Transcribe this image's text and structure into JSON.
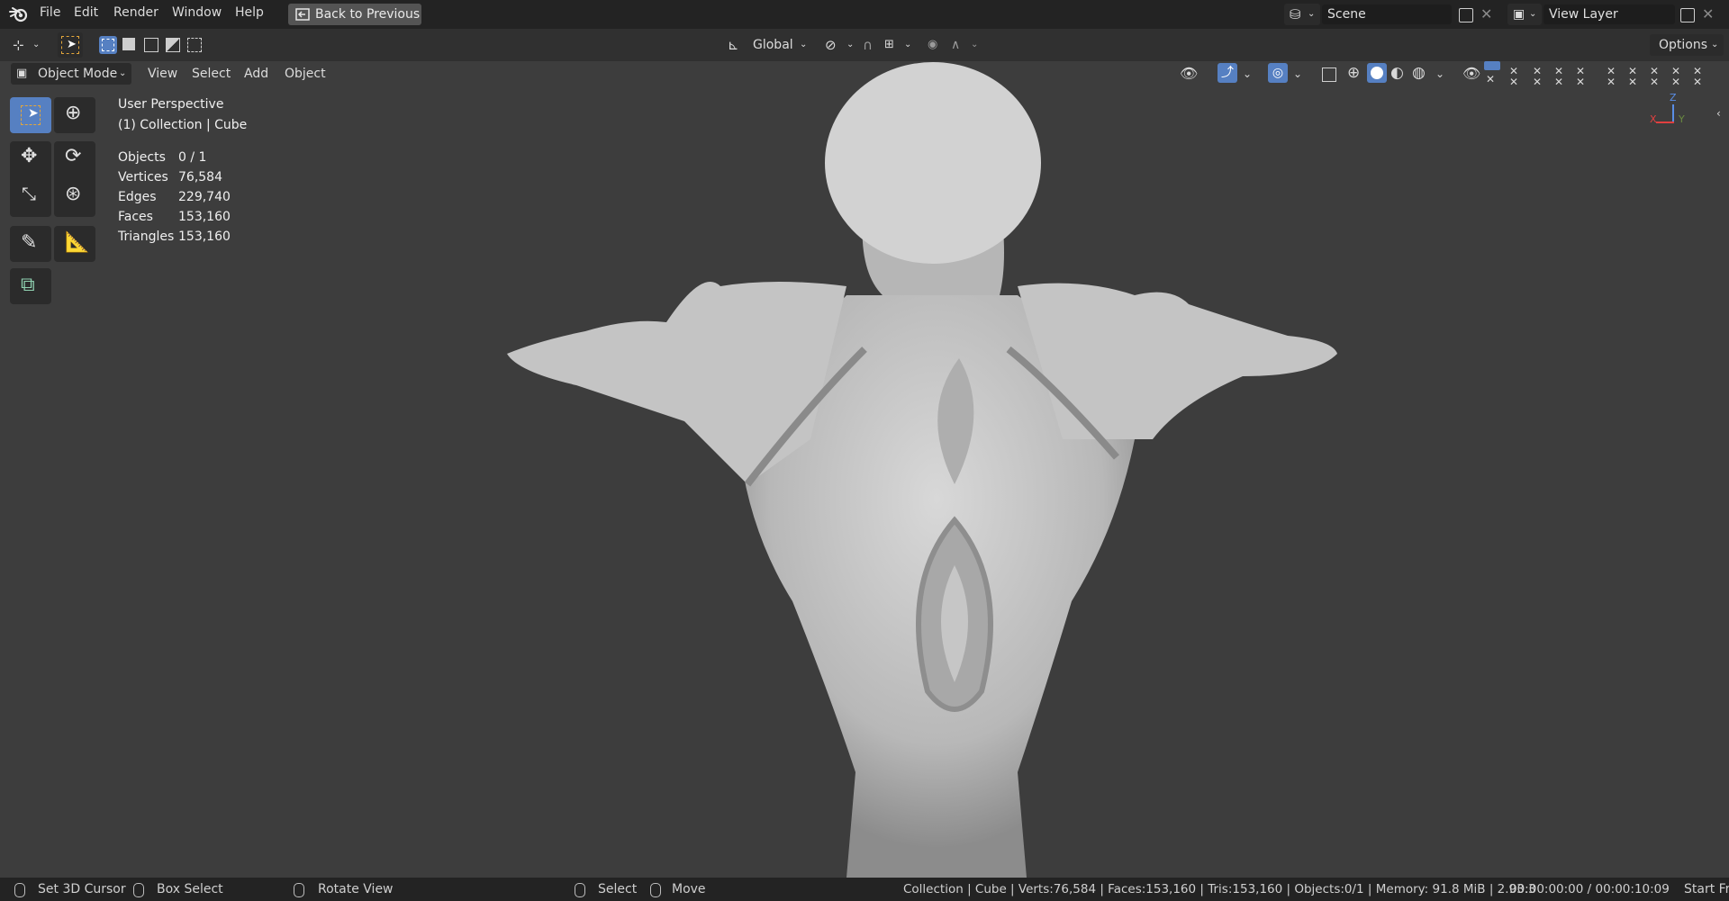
{
  "menu": {
    "file": "File",
    "edit": "Edit",
    "render": "Render",
    "window": "Window",
    "help": "Help"
  },
  "back_button": "Back to Previous",
  "scene": {
    "label": "Scene"
  },
  "view_layer": {
    "label": "View Layer"
  },
  "toolhead": {
    "orientation": "Global",
    "options": "Options"
  },
  "viewport_header": {
    "mode": "Object Mode",
    "view": "View",
    "select": "Select",
    "add": "Add",
    "object": "Object"
  },
  "viewport": {
    "perspective": "User Perspective",
    "collection": "(1) Collection | Cube",
    "stats": [
      {
        "label": "Objects",
        "value": "0 / 1"
      },
      {
        "label": "Vertices",
        "value": "76,584"
      },
      {
        "label": "Edges",
        "value": "229,740"
      },
      {
        "label": "Faces",
        "value": "153,160"
      },
      {
        "label": "Triangles",
        "value": "153,160"
      }
    ],
    "gizmo": {
      "z": "Z",
      "x": "X",
      "y": "Y"
    }
  },
  "statusbar": {
    "set_cursor": "Set 3D Cursor",
    "box_select": "Box Select",
    "rotate_view": "Rotate View",
    "select": "Select",
    "move": "Move",
    "info": "Collection | Cube | Verts:76,584 | Faces:153,160 | Tris:153,160 | Objects:0/1 | Memory: 91.8 MiB | 2.93.3",
    "time": "00:00:00:00 / 00:00:10:09",
    "start": "Start Fra"
  },
  "colors": {
    "accent": "#5680c2",
    "background": "#3d3d3d",
    "model": "#bfbfbf"
  }
}
